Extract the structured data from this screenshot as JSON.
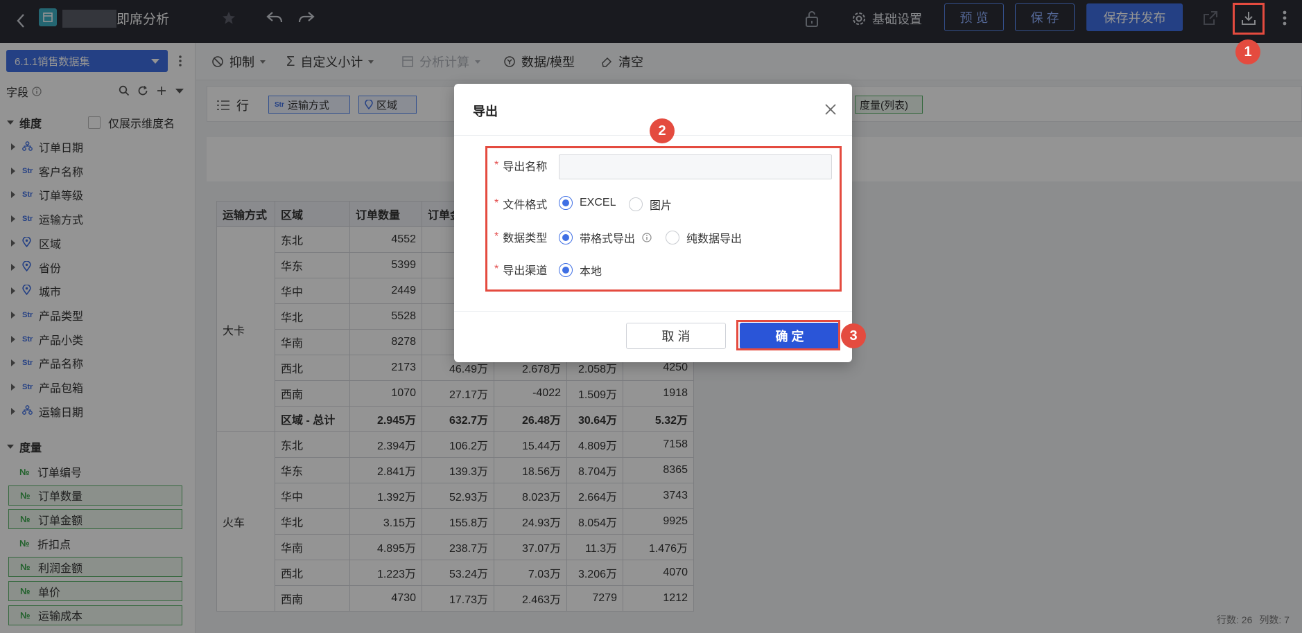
{
  "topbar": {
    "title": "即席分析",
    "settings_label": "基础设置",
    "preview_label": "预 览",
    "save_label": "保 存",
    "publish_label": "保存并发布"
  },
  "toolbar": {
    "suppress_label": "抑制",
    "subtotal_label": "自定义小计",
    "analysis_label": "分析计算",
    "model_label": "数据/模型",
    "clear_label": "清空"
  },
  "sidebar": {
    "dataset": "6.1.1销售数据集",
    "fields_label": "字段",
    "dimension_label": "维度",
    "only_dim_label": "仅展示维度名",
    "dimensions": [
      {
        "type": "hier",
        "label": "订单日期"
      },
      {
        "type": "Str",
        "label": "客户名称"
      },
      {
        "type": "Str",
        "label": "订单等级"
      },
      {
        "type": "Str",
        "label": "运输方式"
      },
      {
        "type": "geo",
        "label": "区域"
      },
      {
        "type": "geo",
        "label": "省份"
      },
      {
        "type": "geo",
        "label": "城市"
      },
      {
        "type": "Str",
        "label": "产品类型"
      },
      {
        "type": "Str",
        "label": "产品小类"
      },
      {
        "type": "Str",
        "label": "产品名称"
      },
      {
        "type": "Str",
        "label": "产品包箱"
      },
      {
        "type": "hier",
        "label": "运输日期"
      }
    ],
    "measure_label": "度量",
    "measures": [
      {
        "label": "订单编号",
        "selected": false
      },
      {
        "label": "订单数量",
        "selected": true
      },
      {
        "label": "订单金额",
        "selected": true
      },
      {
        "label": "折扣点",
        "selected": false
      },
      {
        "label": "利润金额",
        "selected": true
      },
      {
        "label": "单价",
        "selected": true
      },
      {
        "label": "运输成本",
        "selected": true
      }
    ]
  },
  "shelf": {
    "row_label": "行",
    "row_chip_1": "运输方式",
    "row_chip_2": "区域",
    "measure_chip": "度量(列表)"
  },
  "table": {
    "headers": [
      "运输方式",
      "区域",
      "订单数量",
      "订单金"
    ],
    "group1": "大卡",
    "group2": "火车",
    "rows1": [
      [
        "东北",
        "4552",
        "",
        "",
        "",
        ""
      ],
      [
        "华东",
        "5399",
        "",
        "",
        "",
        ""
      ],
      [
        "华中",
        "2449",
        "",
        "",
        "",
        ""
      ],
      [
        "华北",
        "5528",
        "",
        "",
        "",
        ""
      ],
      [
        "华南",
        "8278",
        "",
        "",
        "",
        ""
      ],
      [
        "西北",
        "2173",
        "46.49万",
        "2.678万",
        "2.058万",
        "4250"
      ],
      [
        "西南",
        "1070",
        "27.17万",
        "-4022",
        "1.509万",
        "1918"
      ]
    ],
    "total1": [
      "区域 - 总计",
      "2.945万",
      "632.7万",
      "26.48万",
      "30.64万",
      "5.32万"
    ],
    "rows2": [
      [
        "东北",
        "2.394万",
        "106.2万",
        "15.44万",
        "4.809万",
        "7158"
      ],
      [
        "华东",
        "2.841万",
        "139.3万",
        "18.56万",
        "8.704万",
        "8365"
      ],
      [
        "华中",
        "1.392万",
        "52.93万",
        "8.023万",
        "2.664万",
        "3743"
      ],
      [
        "华北",
        "3.15万",
        "155.8万",
        "24.93万",
        "8.054万",
        "9925"
      ],
      [
        "华南",
        "4.895万",
        "238.7万",
        "37.07万",
        "11.3万",
        "1.476万"
      ],
      [
        "西北",
        "1.223万",
        "53.24万",
        "7.03万",
        "3.206万",
        "4070"
      ],
      [
        "西南",
        "4730",
        "17.73万",
        "2.463万",
        "7279",
        "1212"
      ]
    ]
  },
  "status": {
    "rows": "行数: 26",
    "cols": "列数: 7"
  },
  "modal": {
    "title": "导出",
    "name_label": "导出名称",
    "name_value": "",
    "format_label": "文件格式",
    "format_excel": "EXCEL",
    "format_image": "图片",
    "type_label": "数据类型",
    "type_formatted": "带格式导出",
    "type_raw": "纯数据导出",
    "channel_label": "导出渠道",
    "channel_local": "本地",
    "cancel_label": "取 消",
    "ok_label": "确 定"
  },
  "badges": {
    "b1": "1",
    "b2": "2",
    "b3": "3"
  },
  "colors": {
    "accent": "#3f6fe4",
    "annotation": "#e44b3f",
    "topbar": "#2b2d36"
  }
}
